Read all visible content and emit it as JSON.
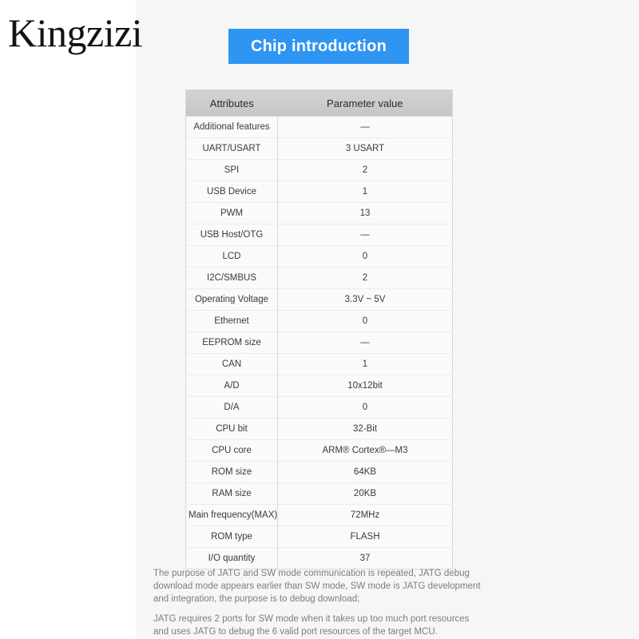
{
  "brand": {
    "logo_text": "Kingzizi"
  },
  "banner": {
    "title": "Chip introduction",
    "accent_color": "#2f95f2"
  },
  "table": {
    "headers": [
      "Attributes",
      "Parameter value"
    ],
    "rows": [
      {
        "attribute": "Additional features",
        "value": "—"
      },
      {
        "attribute": "UART/USART",
        "value": "3 USART"
      },
      {
        "attribute": "SPI",
        "value": "2"
      },
      {
        "attribute": "USB Device",
        "value": "1"
      },
      {
        "attribute": "PWM",
        "value": "13"
      },
      {
        "attribute": "USB Host/OTG",
        "value": "—"
      },
      {
        "attribute": "LCD",
        "value": "0"
      },
      {
        "attribute": "I2C/SMBUS",
        "value": "2"
      },
      {
        "attribute": "Operating Voltage",
        "value": "3.3V ~ 5V"
      },
      {
        "attribute": "Ethernet",
        "value": "0"
      },
      {
        "attribute": "EEPROM size",
        "value": "—"
      },
      {
        "attribute": "CAN",
        "value": "1"
      },
      {
        "attribute": "A/D",
        "value": "10x12bit"
      },
      {
        "attribute": "D/A",
        "value": "0"
      },
      {
        "attribute": "CPU bit",
        "value": "32-Bit"
      },
      {
        "attribute": "CPU core",
        "value": "ARM® Cortex®—M3"
      },
      {
        "attribute": "ROM size",
        "value": "64KB"
      },
      {
        "attribute": "RAM size",
        "value": "20KB"
      },
      {
        "attribute": "Main frequency(MAX)",
        "value": "72MHz"
      },
      {
        "attribute": "ROM type",
        "value": "FLASH"
      },
      {
        "attribute": "I/O quantity",
        "value": "37"
      }
    ]
  },
  "notes": {
    "paragraph_1": "The purpose of JATG and SW mode communication is repeated, JATG debug download mode appears earlier than SW mode, SW mode is JATG development and integration, the purpose is to debug download;",
    "paragraph_2": "JATG requires 2 ports for SW mode when it takes up too much port resources and uses JATG to debug the 6 valid port resources of the target MCU."
  }
}
